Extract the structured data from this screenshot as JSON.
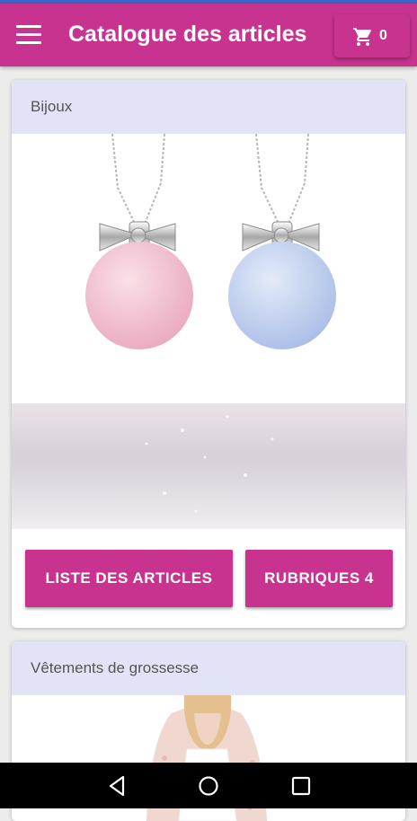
{
  "colors": {
    "accent": "#c8338f",
    "header_bg": "#e3e3f7",
    "status_line": "#3b63c8"
  },
  "appbar": {
    "menu_icon": "menu-icon",
    "title": "Catalogue des articles",
    "cart_icon": "cart-icon",
    "cart_count": "0"
  },
  "cards": [
    {
      "category": "Bijoux",
      "image": "two-pendant-necklaces-pink-and-blue",
      "list_button": "LISTE DES ARTICLES",
      "rubriques_button": "RUBRIQUES 4"
    },
    {
      "category": "Vêtements de grossesse",
      "image": "woman-with-lace-jacket"
    }
  ],
  "navbar": {
    "back_icon": "back-icon",
    "home_icon": "home-icon",
    "recents_icon": "recents-icon"
  }
}
